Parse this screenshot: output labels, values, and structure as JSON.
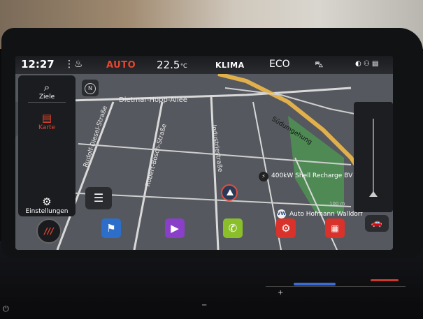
{
  "status_bar": {
    "time": "12:27",
    "auto_label": "AUTO",
    "temperature": "22.5",
    "temperature_unit": "°C",
    "klima_label": "KLIMA",
    "eco_label": "ECO"
  },
  "sidebar": {
    "items": [
      {
        "label": "Ziele",
        "icon": "destination-search-icon"
      },
      {
        "label": "Karte",
        "icon": "map-icon",
        "active": true
      },
      {
        "label": "Einstellungen",
        "icon": "gear-icon"
      }
    ]
  },
  "map": {
    "compass_label": "N",
    "streets": [
      "Dietmar-Hopp-Allee",
      "Rudolf-Diesel-Straße",
      "Robert-Bosch-Straße",
      "Industriestraße",
      "Südumgehung"
    ],
    "poi_charging": "400kW Shell Recharge BV",
    "poi_dealer": "Auto Hofmann Walldorf",
    "distance_label": "100 m"
  },
  "dock": {
    "items": [
      {
        "name": "seat-button",
        "label": "///"
      },
      {
        "name": "navigation-app-button",
        "icon": "flag-icon"
      },
      {
        "name": "media-app-button",
        "icon": "play-icon"
      },
      {
        "name": "phone-app-button",
        "icon": "phone-icon"
      },
      {
        "name": "settings-app-button",
        "icon": "gear-icon"
      },
      {
        "name": "apps-button",
        "icon": "apps-icon"
      }
    ]
  },
  "colors": {
    "accent": "#e8452c",
    "navigation": "#2c6ec9",
    "media": "#8a3fc9",
    "phone": "#8bbf2a",
    "settings": "#d8322a",
    "road_highlight": "#e2b04a",
    "park_green": "#4f8a55"
  }
}
